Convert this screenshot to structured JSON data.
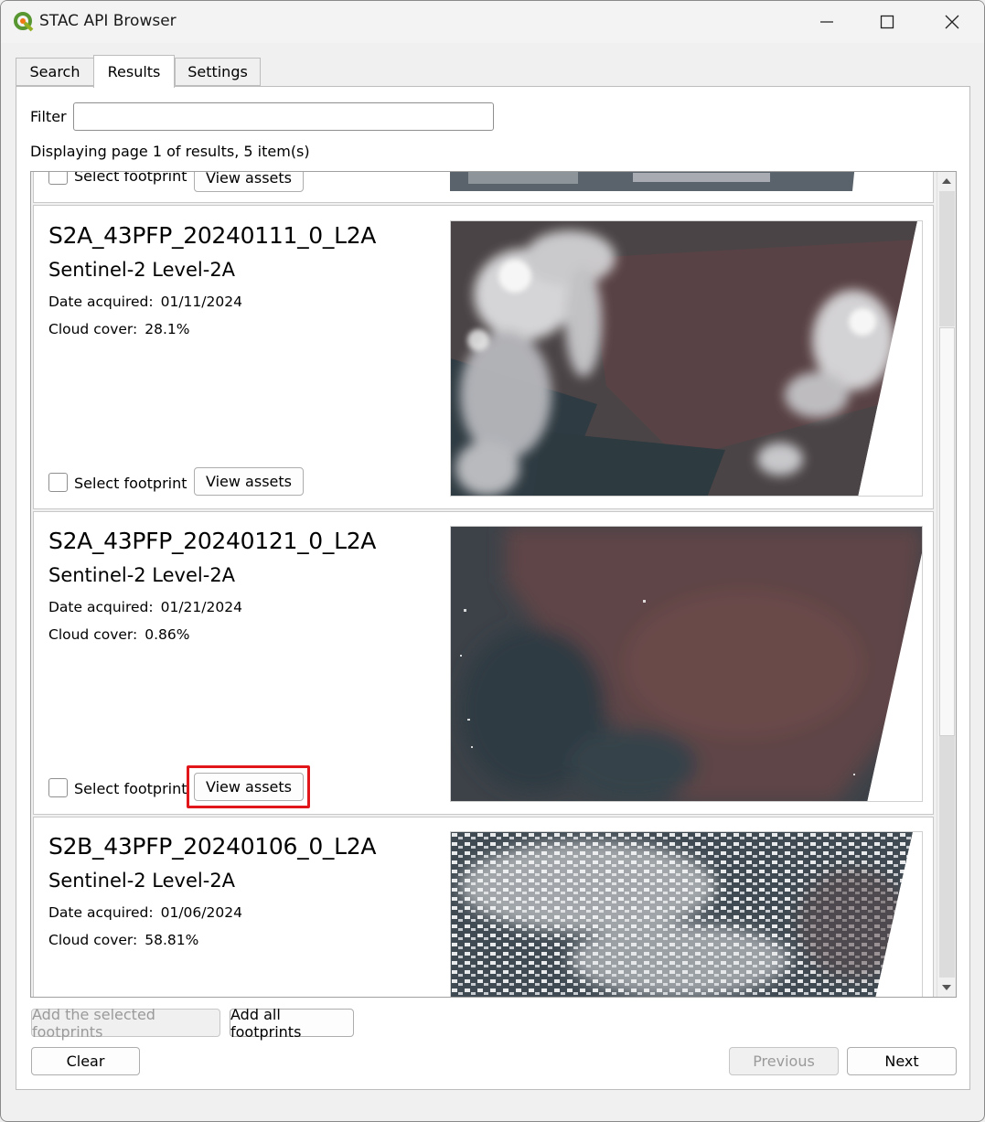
{
  "window": {
    "title": "STAC API Browser",
    "icon": "qgis-logo-icon",
    "controls": [
      "minimize-icon",
      "maximize-icon",
      "close-icon"
    ]
  },
  "tabs": [
    {
      "label": "Search",
      "active": false
    },
    {
      "label": "Results",
      "active": true
    },
    {
      "label": "Settings",
      "active": false
    }
  ],
  "filter": {
    "label": "Filter",
    "value": "",
    "placeholder": ""
  },
  "status": "Displaying page 1 of results, 5 item(s)",
  "partial_card": {
    "checkbox_label": "Select footprint",
    "button_label": "View assets"
  },
  "items": [
    {
      "id": "S2A_43PFP_20240111_0_L2A",
      "collection": "Sentinel-2 Level-2A",
      "date_label": "Date acquired:",
      "date": "01/11/2024",
      "cloud_label": "Cloud cover:",
      "cloud": "28.1%",
      "checkbox_label": "Select footprint",
      "button_label": "View assets"
    },
    {
      "id": "S2A_43PFP_20240121_0_L2A",
      "collection": "Sentinel-2 Level-2A",
      "date_label": "Date acquired:",
      "date": "01/21/2024",
      "cloud_label": "Cloud cover:",
      "cloud": "0.86%",
      "checkbox_label": "Select footprint",
      "button_label": "View assets",
      "highlighted": true
    },
    {
      "id": "S2B_43PFP_20240106_0_L2A",
      "collection": "Sentinel-2 Level-2A",
      "date_label": "Date acquired:",
      "date": "01/06/2024",
      "cloud_label": "Cloud cover:",
      "cloud": "58.81%"
    }
  ],
  "footer": {
    "add_selected": "Add the selected footprints",
    "add_all": "Add all footprints",
    "clear": "Clear",
    "previous": "Previous",
    "next": "Next"
  },
  "colors": {
    "highlight": "#e0161b",
    "panel": "#ffffff",
    "background": "#f0f0f0"
  }
}
